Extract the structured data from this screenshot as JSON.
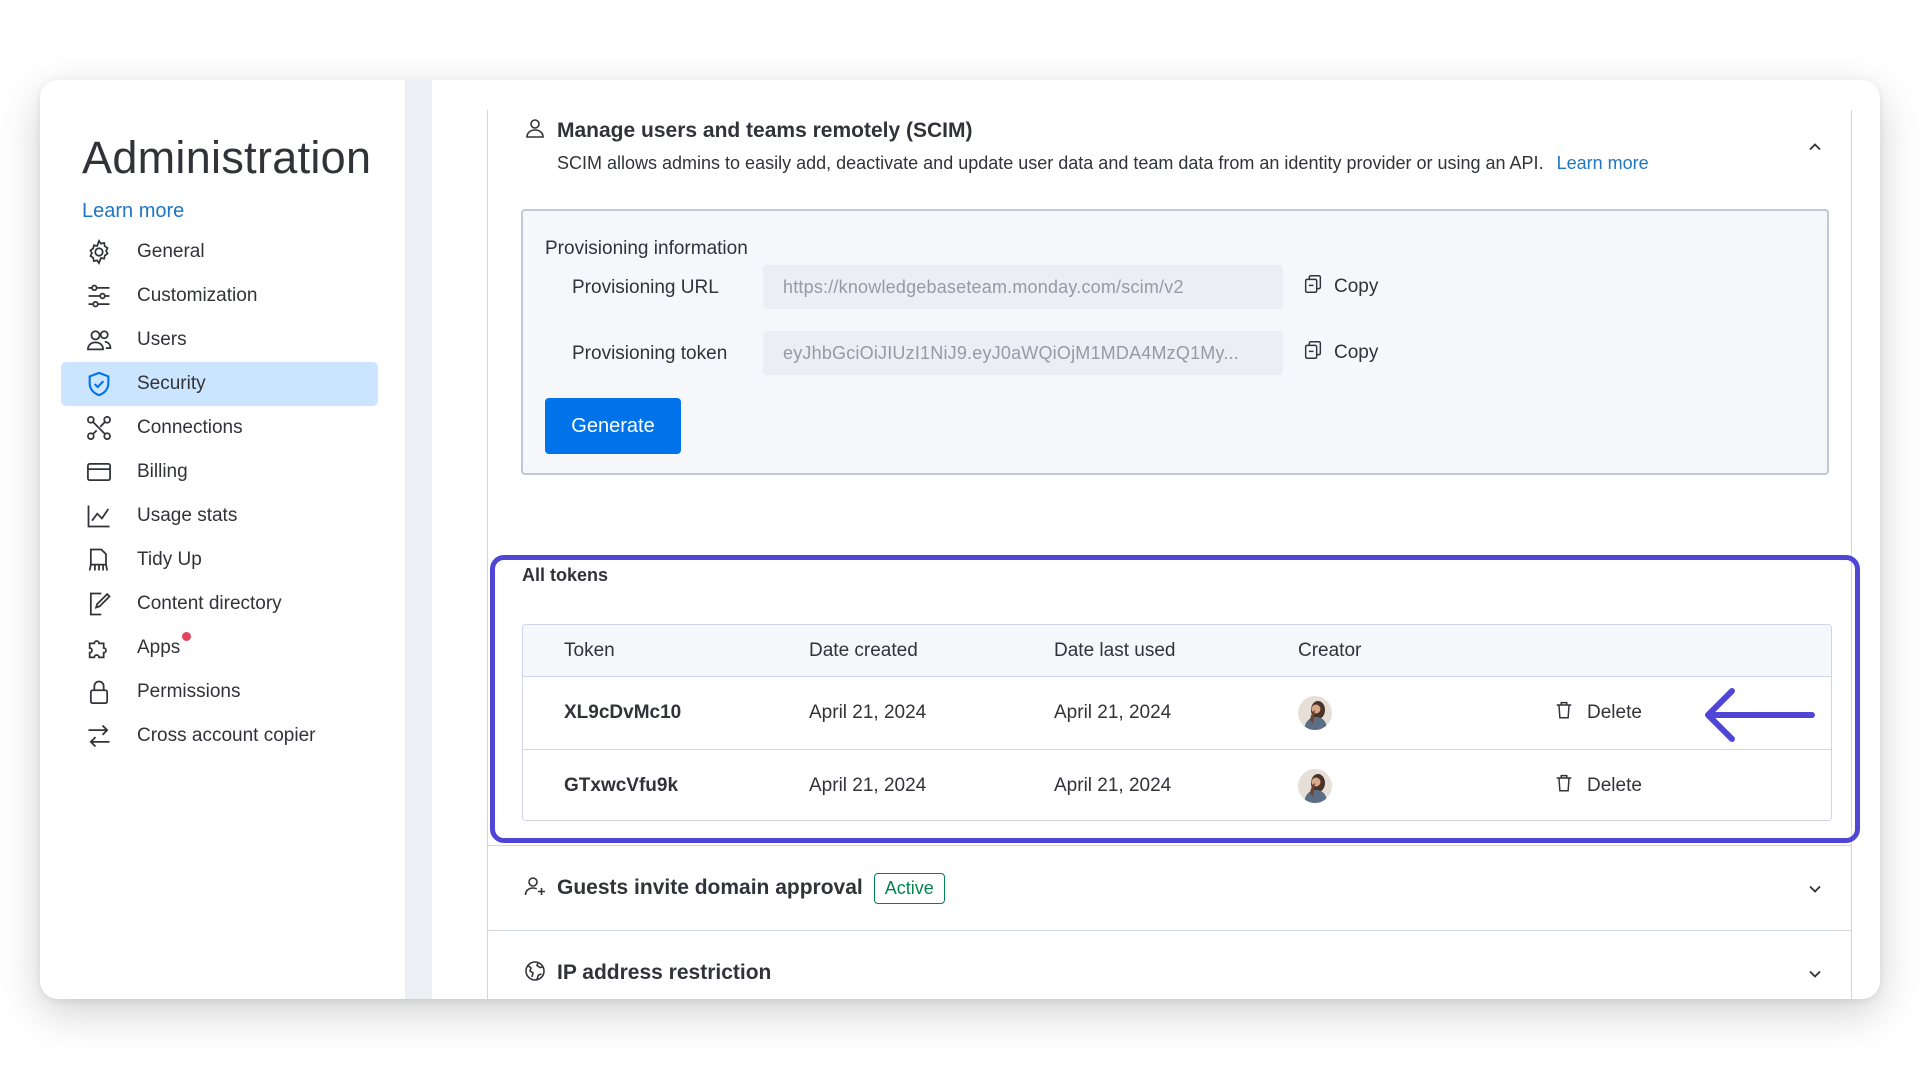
{
  "sidebar": {
    "title": "Administration",
    "learn_more": "Learn more",
    "items": [
      {
        "label": "General",
        "icon": "gear-icon"
      },
      {
        "label": "Customization",
        "icon": "sliders-icon"
      },
      {
        "label": "Users",
        "icon": "users-icon"
      },
      {
        "label": "Security",
        "icon": "shield-icon",
        "active": true
      },
      {
        "label": "Connections",
        "icon": "connections-icon"
      },
      {
        "label": "Billing",
        "icon": "credit-card-icon"
      },
      {
        "label": "Usage stats",
        "icon": "chart-icon"
      },
      {
        "label": "Tidy Up",
        "icon": "broom-icon"
      },
      {
        "label": "Content directory",
        "icon": "edit-document-icon"
      },
      {
        "label": "Apps",
        "icon": "puzzle-icon",
        "notification": true
      },
      {
        "label": "Permissions",
        "icon": "lock-icon"
      },
      {
        "label": "Cross account copier",
        "icon": "transfer-icon"
      }
    ]
  },
  "scim": {
    "title": "Manage users and teams remotely (SCIM)",
    "description": "SCIM allows admins to easily add, deactivate and update user data and team data from an identity provider or using an API.",
    "learn_more": "Learn more",
    "provisioning": {
      "title": "Provisioning information",
      "url_label": "Provisioning URL",
      "url_value": "https://knowledgebaseteam.monday.com/scim/v2",
      "token_label": "Provisioning token",
      "token_value": "eyJhbGciOiJIUzI1NiJ9.eyJ0aWQiOjM1MDA4MzQ1My...",
      "copy_label": "Copy",
      "generate_label": "Generate"
    }
  },
  "tokens": {
    "title": "All tokens",
    "columns": {
      "token": "Token",
      "created": "Date created",
      "last_used": "Date last used",
      "creator": "Creator"
    },
    "rows": [
      {
        "token": "XL9cDvMc10",
        "created": "April 21, 2024",
        "last_used": "April 21, 2024",
        "delete_label": "Delete"
      },
      {
        "token": "GTxwcVfu9k",
        "created": "April 21, 2024",
        "last_used": "April 21, 2024",
        "delete_label": "Delete"
      }
    ],
    "highlight_color": "#4f46d6"
  },
  "guests": {
    "title": "Guests invite domain approval",
    "status": "Active"
  },
  "ip": {
    "title": "IP address restriction"
  },
  "colors": {
    "accent": "#0073ea",
    "link": "#1f76c2",
    "active_nav": "#cce5ff",
    "success": "#00854d",
    "annotation": "#4f46d6",
    "notification": "#e2445c"
  }
}
